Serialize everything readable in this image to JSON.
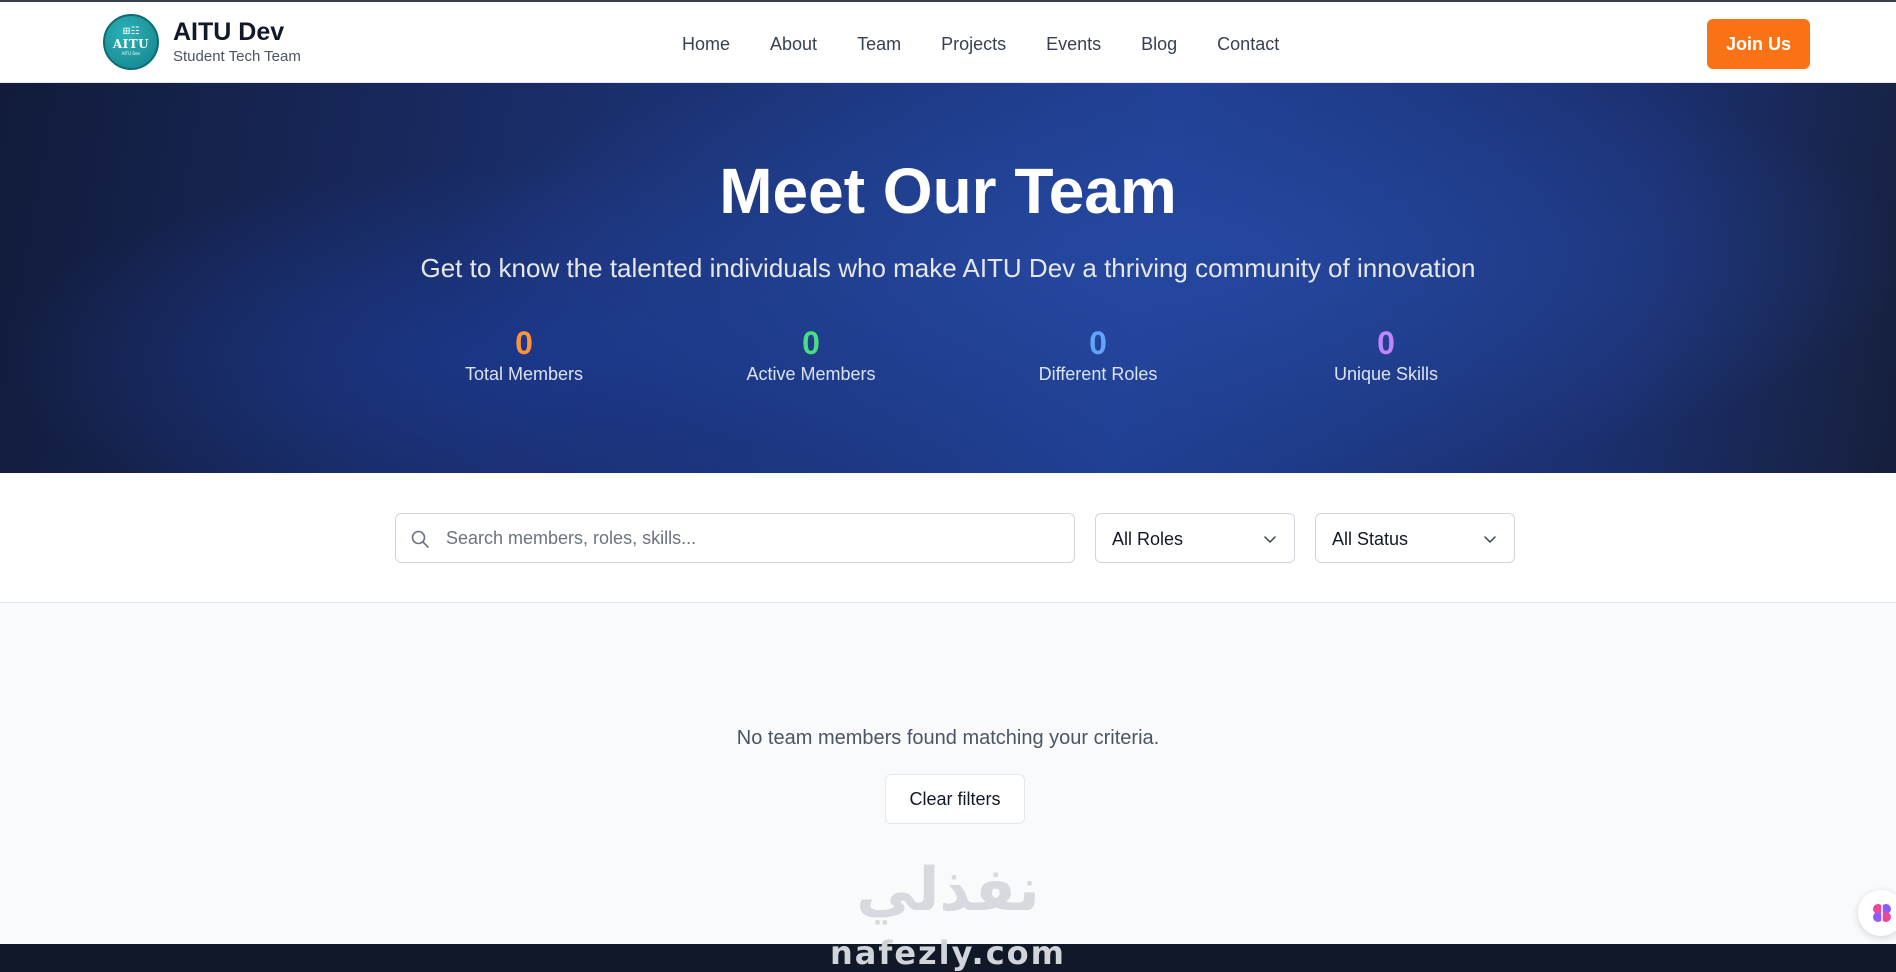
{
  "brand": {
    "title": "AITU Dev",
    "subtitle": "Student Tech Team",
    "logo": {
      "line1": "⊞☷",
      "line2": "AITU",
      "line3": "AITU Dev"
    }
  },
  "nav": {
    "items": [
      "Home",
      "About",
      "Team",
      "Projects",
      "Events",
      "Blog",
      "Contact"
    ]
  },
  "header": {
    "join_label": "Join Us"
  },
  "hero": {
    "title": "Meet Our Team",
    "subtitle": "Get to know the talented individuals who make AITU Dev a thriving community of innovation",
    "stats": [
      {
        "value": "0",
        "label": "Total Members",
        "color": "#fb923c"
      },
      {
        "value": "0",
        "label": "Active Members",
        "color": "#4ade80"
      },
      {
        "value": "0",
        "label": "Different Roles",
        "color": "#60a5fa"
      },
      {
        "value": "0",
        "label": "Unique Skills",
        "color": "#c084fc"
      }
    ]
  },
  "filters": {
    "search_placeholder": "Search members, roles, skills...",
    "roles_selected": "All Roles",
    "status_selected": "All Status"
  },
  "empty_state": {
    "message": "No team members found matching your criteria.",
    "clear_label": "Clear filters"
  },
  "watermark": {
    "arabic": "نفذلي",
    "latin": "nafezly.com"
  },
  "colors": {
    "accent": "#f97316",
    "hero_dark": "#121b3a",
    "hero_blue": "#203f93"
  }
}
